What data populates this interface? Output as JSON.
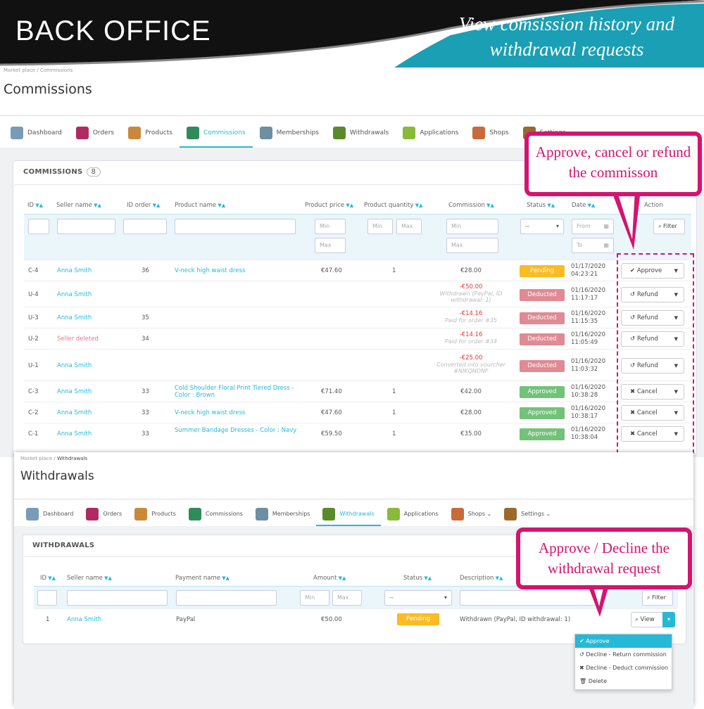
{
  "banner": {
    "title": "BACK OFFICE",
    "tagline": "View comsission history and withdrawal requests"
  },
  "commissions_page": {
    "breadcrumb": "Market place / Commissions",
    "title": "Commissions",
    "tabs": [
      {
        "label": "Dashboard",
        "icon": "dashboard-icon"
      },
      {
        "label": "Orders",
        "icon": "cart-icon"
      },
      {
        "label": "Products",
        "icon": "boxes-icon"
      },
      {
        "label": "Commissions",
        "icon": "money-bag-icon",
        "active": true
      },
      {
        "label": "Memberships",
        "icon": "membership-icon"
      },
      {
        "label": "Withdrawals",
        "icon": "wallet-icon"
      },
      {
        "label": "Applications",
        "icon": "check-hand-icon"
      },
      {
        "label": "Shops",
        "icon": "shop-icon"
      },
      {
        "label": "Settings",
        "icon": "gear-icon"
      }
    ],
    "panel_title": "COMMISSIONS",
    "count": "8",
    "columns": [
      "ID",
      "Seller name",
      "ID order",
      "Product name",
      "Product price",
      "Product quantity",
      "Commission",
      "Status",
      "Date",
      "Action"
    ],
    "filters": {
      "min": "Min",
      "max": "Max",
      "status": "--",
      "from": "From",
      "to": "To",
      "filter_button": "Filter"
    },
    "rows": [
      {
        "id": "C-4",
        "seller": "Anna Smith",
        "order": "36",
        "product": "V-neck high waist dress",
        "price": "€47.60",
        "qty": "1",
        "commission": "€28.00",
        "note": "",
        "status": "Pending",
        "date": "01/17/2020",
        "time": "04:23:21",
        "action": "Approve"
      },
      {
        "id": "U-4",
        "seller": "Anna Smith",
        "order": "",
        "product": "",
        "price": "",
        "qty": "",
        "commission": "-€50.00",
        "note": "Withdrawn (PayPal, ID withdrawal: 1)",
        "status": "Deducted",
        "date": "01/16/2020",
        "time": "11:17:17",
        "action": "Refund"
      },
      {
        "id": "U-3",
        "seller": "Anna Smith",
        "order": "35",
        "product": "",
        "price": "",
        "qty": "",
        "commission": "-€14.16",
        "note": "Paid for order #35",
        "status": "Deducted",
        "date": "01/16/2020",
        "time": "11:15:35",
        "action": "Refund"
      },
      {
        "id": "U-2",
        "seller": "Seller deleted",
        "order": "34",
        "product": "",
        "price": "",
        "qty": "",
        "commission": "-€14.16",
        "note": "Paid for order #34",
        "status": "Deducted",
        "date": "01/16/2020",
        "time": "11:05:49",
        "action": "Refund"
      },
      {
        "id": "U-1",
        "seller": "Anna Smith",
        "order": "",
        "product": "",
        "price": "",
        "qty": "",
        "commission": "-€25.00",
        "note": "Converted into vourcher #NIKQNDNF",
        "status": "Deducted",
        "date": "01/16/2020",
        "time": "11:03:32",
        "action": "Refund"
      },
      {
        "id": "C-3",
        "seller": "Anna Smith",
        "order": "33",
        "product": "Cold Shoulder Floral Print Tiered Dress - Color : Brown",
        "price": "€71.40",
        "qty": "1",
        "commission": "€42.00",
        "note": "",
        "status": "Approved",
        "date": "01/16/2020",
        "time": "10:38:28",
        "action": "Cancel"
      },
      {
        "id": "C-2",
        "seller": "Anna Smith",
        "order": "33",
        "product": "V-neck high waist dress",
        "price": "€47.60",
        "qty": "1",
        "commission": "€28.00",
        "note": "",
        "status": "Approved",
        "date": "01/16/2020",
        "time": "10:38:17",
        "action": "Cancel"
      },
      {
        "id": "C-1",
        "seller": "Anna Smith",
        "order": "33",
        "product": "Summer Bandage Dresses - Color : Navy",
        "price": "€59.50",
        "qty": "1",
        "commission": "€35.00",
        "note": "",
        "status": "Approved",
        "date": "01/16/2020",
        "time": "10:38:04",
        "action": "Cancel"
      }
    ],
    "callout": "Approve, cancel or refund the commisson"
  },
  "withdrawals_page": {
    "breadcrumb_root": "Market place",
    "breadcrumb_current": "Withdrawals",
    "title": "Withdrawals",
    "tabs": [
      {
        "label": "Dashboard"
      },
      {
        "label": "Orders"
      },
      {
        "label": "Products"
      },
      {
        "label": "Commissions"
      },
      {
        "label": "Memberships"
      },
      {
        "label": "Withdrawals",
        "active": true
      },
      {
        "label": "Applications"
      },
      {
        "label": "Shops ⌄"
      },
      {
        "label": "Settings ⌄"
      }
    ],
    "panel_title": "WITHDRAWALS",
    "columns": [
      "ID",
      "Seller name",
      "Payment name",
      "Amount",
      "Status",
      "Description"
    ],
    "filters": {
      "min": "Min",
      "max": "Max",
      "status": "--",
      "filter_button": "Filter"
    },
    "row": {
      "id": "1",
      "seller": "Anna Smith",
      "payment": "PayPal",
      "amount": "€50.00",
      "status": "Pending",
      "description": "Withdrawn (PayPal, ID withdrawal: 1)",
      "view": "View"
    },
    "menu": [
      "Approve",
      "Decline - Return commission",
      "Decline - Deduct commission",
      "Delete"
    ],
    "callout": "Approve / Decline the withdrawal request"
  },
  "colors": {
    "accent": "#25b9d7",
    "pending": "#fbbb22",
    "deducted": "#e08a93",
    "approved": "#72c279",
    "callout": "#d4146f",
    "banner_teal": "#1a9fb4"
  }
}
